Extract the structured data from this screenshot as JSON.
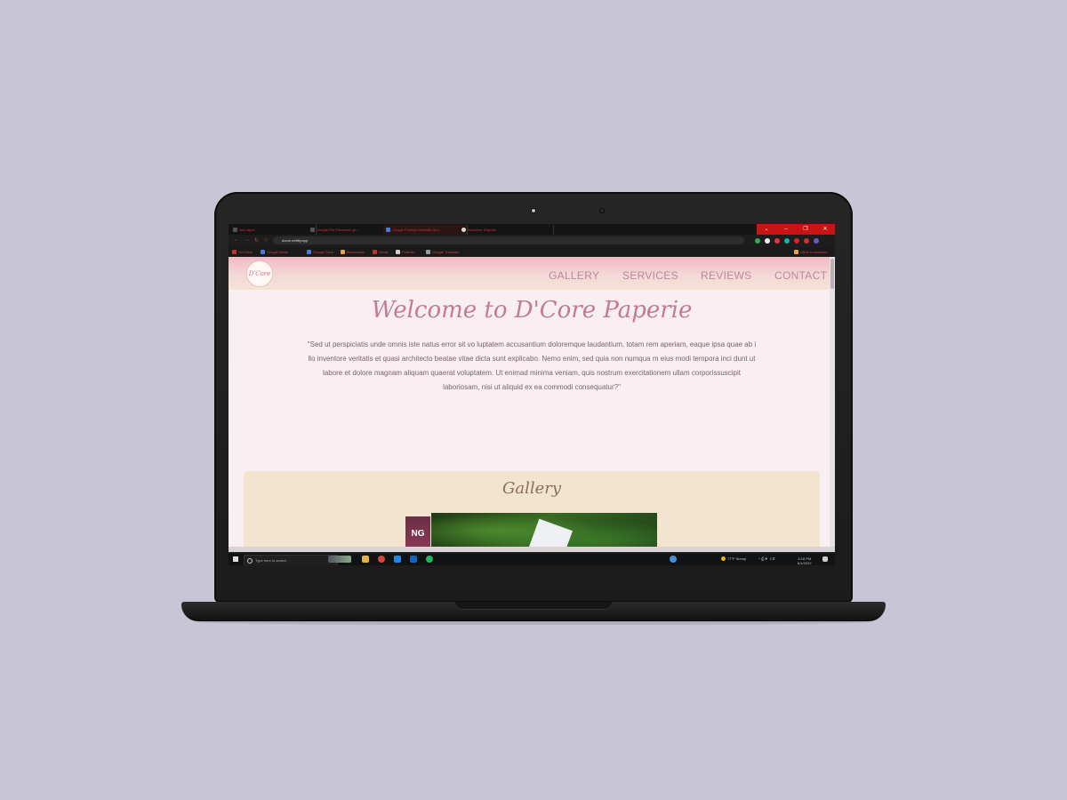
{
  "browser": {
    "tabs": [
      {
        "label": "Ikon Apps"
      },
      {
        "label": "Google Pro Freelance ge..."
      },
      {
        "label": "Google Portfolio Website Gen..."
      },
      {
        "label": "Welcome Graphic"
      }
    ],
    "window_controls": [
      "⌄",
      "–",
      "❐",
      "✕"
    ],
    "url": "dcore.netlify.app",
    "bookmarks": [
      {
        "label": "YouTube"
      },
      {
        "label": "Google Maps"
      },
      {
        "label": "Google Docs"
      },
      {
        "label": "Bookmarks"
      },
      {
        "label": "Gmail"
      },
      {
        "label": "Portfolio"
      },
      {
        "label": "Google Translate"
      },
      {
        "label": "Other bookmarks"
      }
    ]
  },
  "site": {
    "logo_text": "D'Core",
    "nav": [
      "GALLERY",
      "SERVICES",
      "REVIEWS",
      "CONTACT"
    ],
    "hero_title": "Welcome to D'Core Paperie",
    "quote": "\"Sed ut perspiciatis unde omnis iste natus error sit vo luptatem accusantium doloremque laudantium, totam rem aperiam, eaque ipsa quae ab i llo inventore veritatis et quasi architecto beatae vitae dicta sunt explicabo. Nemo enim, sed quia non numqua m eius modi tempora inci dunt ut labore et dolore magnam aliquam quaerat voluptatem. Ut enimad minima veniam, quis nostrum exercitationem ullam corporissuscipit laboriosam, nisi ut aliquid ex ea commodi consequatur?\"",
    "gallery_title": "Gallery",
    "gallery_badge": "NG"
  },
  "taskbar": {
    "search_placeholder": "Type here to search",
    "weather": "77°F Sunny",
    "clock_time": "4:18 PM",
    "clock_date": "6/1/2022"
  },
  "colors": {
    "hero_title": "#c47b91",
    "nav_link": "#b98a98",
    "gallery_bg": "#f3e4cf",
    "page_bg": "#f9eff3"
  }
}
